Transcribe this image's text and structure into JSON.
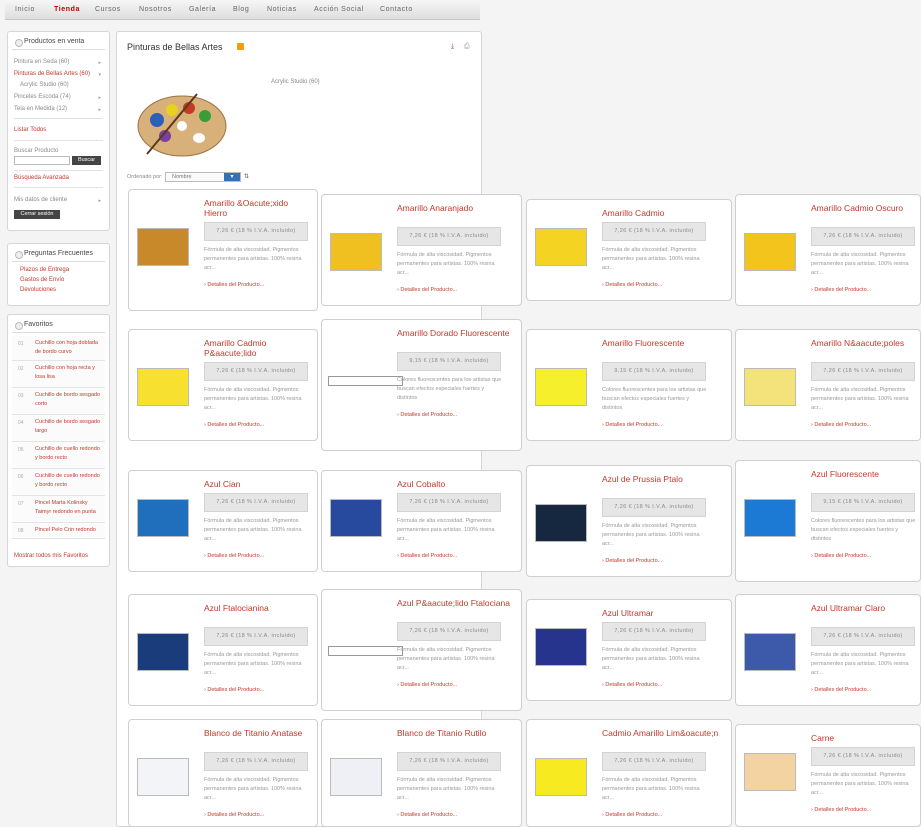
{
  "nav": [
    "Inicio",
    "Tienda",
    "Cursos",
    "Nosotros",
    "Galería",
    "Blog",
    "Noticias",
    "Acción Social",
    "Contacto"
  ],
  "sidebar": {
    "products_title": "Productos en venta",
    "products": [
      {
        "label": "Pintura en Seda (60)"
      },
      {
        "label": "Pinturas de Bellas Artes (60)"
      },
      {
        "label": "Acrylic Studio (60)"
      },
      {
        "label": "Pinceles Escoda (74)"
      },
      {
        "label": "Tela en Medida (12)"
      }
    ],
    "list_all": "Listar Todos",
    "search_label": "Buscar Producto",
    "search_button": "Buscar",
    "advanced_search": "Búsqueda Avanzada",
    "client_label": "Mis datos de cliente",
    "close_session": "Cerrar sesión",
    "faq_title": "Preguntas Frecuentes",
    "faq": [
      "Plazos de Entrega",
      "Gastos de Envío",
      "Devoluciones"
    ],
    "fav_title": "Favoritos",
    "favorites": [
      {
        "num": "01",
        "text": "Cuchillo con hoja doblada de bordo curvo"
      },
      {
        "num": "02",
        "text": "Cuchillo con hoja recta y losa lisa"
      },
      {
        "num": "03",
        "text": "Cuchillo de bordo sesgado corto"
      },
      {
        "num": "04",
        "text": "Cuchillo de bordo sesgado largo"
      },
      {
        "num": "05",
        "text": "Cuchillo de cuello redondo y bordo recto"
      },
      {
        "num": "06",
        "text": "Cuchillo de cuello redondo y bordo recto"
      },
      {
        "num": "07",
        "text": "Pincel Marta Kolinsky Taimyr redondo en punta"
      },
      {
        "num": "08",
        "text": "Pincel Pelo Crin redondo"
      }
    ],
    "show_all_fav": "Mostrar todos mis Favoritos"
  },
  "main": {
    "title": "Pinturas de Bellas Artes",
    "subcategory": "Acrylic Studio (60)",
    "order_label": "Ordenado por:",
    "order_value": "Nombre",
    "price_text": "7,26 € (18 % I.V.A. incluido)",
    "price_fluor": "9,15 € (18 % I.V.A. incluido)",
    "desc_text": "Fórmula de alta viscosidad. Pigmentos permanentes para artistas. 100% resina acr...",
    "desc_fluor": "Colores fluorescentes para los artistas que buscan efectos especiales fuertes y distintos",
    "details": "Detalles del Producto..."
  },
  "products": [
    {
      "name": "Amarillo &Oacute;xido Hierro",
      "color": "#c8892a",
      "price": "price_text",
      "desc": "desc_text"
    },
    {
      "name": "Amarillo Anaranjado",
      "color": "#f0c020",
      "price": "price_text",
      "desc": "desc_text"
    },
    {
      "name": "Amarillo Cadmio",
      "color": "#f5d322",
      "price": "price_text",
      "desc": "desc_text"
    },
    {
      "name": "Amarillo Cadmio Oscuro",
      "color": "#f2c41c",
      "price": "price_text",
      "desc": "desc_text"
    },
    {
      "name": "Amarillo Cadmio P&aacute;lido",
      "color": "#f8e030",
      "price": "price_text",
      "desc": "desc_text"
    },
    {
      "name": "Amarillo Dorado Fluorescente",
      "color": "",
      "price": "price_fluor",
      "desc": "desc_fluor"
    },
    {
      "name": "Amarillo Fluorescente",
      "color": "#f6f02c",
      "price": "price_fluor",
      "desc": "desc_fluor"
    },
    {
      "name": "Amarillo N&aacute;poles",
      "color": "#f4e27a",
      "price": "price_text",
      "desc": "desc_text"
    },
    {
      "name": "Azul Cian",
      "color": "#1f6fbd",
      "price": "price_text",
      "desc": "desc_text"
    },
    {
      "name": "Azul Cobalto",
      "color": "#274a9e",
      "price": "price_text",
      "desc": "desc_text"
    },
    {
      "name": "Azul de Prussia Ptalo",
      "color": "#16283f",
      "price": "price_text",
      "desc": "desc_text"
    },
    {
      "name": "Azul Fluorescente",
      "color": "#1d7ad4",
      "price": "price_fluor",
      "desc": "desc_fluor"
    },
    {
      "name": "Azul Ftalocianina",
      "color": "#1a3c7a",
      "price": "price_text",
      "desc": "desc_text"
    },
    {
      "name": "Azul P&aacute;lido Ftalociana",
      "color": "",
      "price": "price_text",
      "desc": "desc_text"
    },
    {
      "name": "Azul Ultramar",
      "color": "#26348e",
      "price": "price_text",
      "desc": "desc_text"
    },
    {
      "name": "Azul Ultramar Claro",
      "color": "#3d59aa",
      "price": "price_text",
      "desc": "desc_text"
    },
    {
      "name": "Blanco de Titanio Anatase",
      "color": "#f2f4f8",
      "price": "price_text",
      "desc": "desc_text"
    },
    {
      "name": "Blanco de Titanio Rutilo",
      "color": "#eef0f5",
      "price": "price_text",
      "desc": "desc_text"
    },
    {
      "name": "Cadmio Amarillo Lim&oacute;n",
      "color": "#f7ea20",
      "price": "price_text",
      "desc": "desc_text"
    },
    {
      "name": "Carne",
      "color": "#f3d3a2",
      "price": "price_text",
      "desc": "desc_text"
    }
  ]
}
